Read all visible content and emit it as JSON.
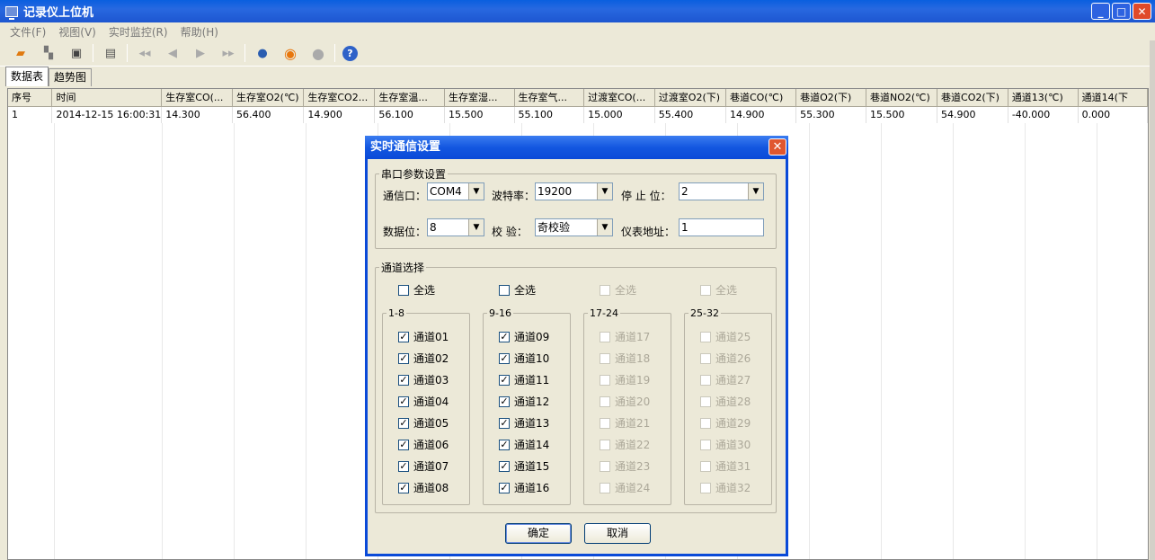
{
  "window": {
    "title": "记录仪上位机"
  },
  "menu": [
    "文件(F)",
    "视图(V)",
    "实时监控(R)",
    "帮助(H)"
  ],
  "toolbar_icons": [
    "open-icon",
    "search-icon",
    "save-icon",
    "print-icon",
    "first-icon",
    "prev-icon",
    "next-icon",
    "last-icon",
    "connect-icon",
    "play-icon",
    "stop-icon",
    "help-icon"
  ],
  "tabs": [
    "数据表",
    "趋势图"
  ],
  "table": {
    "headers": [
      "序号",
      "时间",
      "生存室CO(...",
      "生存室O2(℃)",
      "生存室CO2...",
      "生存室温...",
      "生存室湿...",
      "生存室气...",
      "过渡室CO(...",
      "过渡室O2(下)",
      "巷道CO(℃)",
      "巷道O2(下)",
      "巷道NO2(℃)",
      "巷道CO2(下)",
      "通道13(℃)",
      "通道14(下"
    ],
    "rows": [
      [
        "1",
        "2014-12-15 16:00:31",
        "14.300",
        "56.400",
        "14.900",
        "56.100",
        "15.500",
        "55.100",
        "15.000",
        "55.400",
        "14.900",
        "55.300",
        "15.500",
        "54.900",
        "-40.000",
        "0.000"
      ]
    ]
  },
  "dialog": {
    "title": "实时通信设置",
    "serial": {
      "legend": "串口参数设置",
      "port_label": "通信口：",
      "port": "COM4",
      "baud_label": "波特率：",
      "baud": "19200",
      "stop_label": "停 止 位：",
      "stop": "2",
      "data_label": "数据位：",
      "data": "8",
      "parity_label": "校  验：",
      "parity": "奇校验",
      "addr_label": "仪表地址：",
      "addr": "1"
    },
    "channels": {
      "legend": "通道选择",
      "select_all": "全选",
      "groups": [
        {
          "name": "1-8",
          "enabled": true,
          "items": [
            "通道01",
            "通道02",
            "通道03",
            "通道04",
            "通道05",
            "通道06",
            "通道07",
            "通道08"
          ]
        },
        {
          "name": "9-16",
          "enabled": true,
          "items": [
            "通道09",
            "通道10",
            "通道11",
            "通道12",
            "通道13",
            "通道14",
            "通道15",
            "通道16"
          ]
        },
        {
          "name": "17-24",
          "enabled": false,
          "items": [
            "通道17",
            "通道18",
            "通道19",
            "通道20",
            "通道21",
            "通道22",
            "通道23",
            "通道24"
          ]
        },
        {
          "name": "25-32",
          "enabled": false,
          "items": [
            "通道25",
            "通道26",
            "通道27",
            "通道28",
            "通道29",
            "通道30",
            "通道31",
            "通道32"
          ]
        }
      ]
    },
    "ok": "确定",
    "cancel": "取消"
  }
}
